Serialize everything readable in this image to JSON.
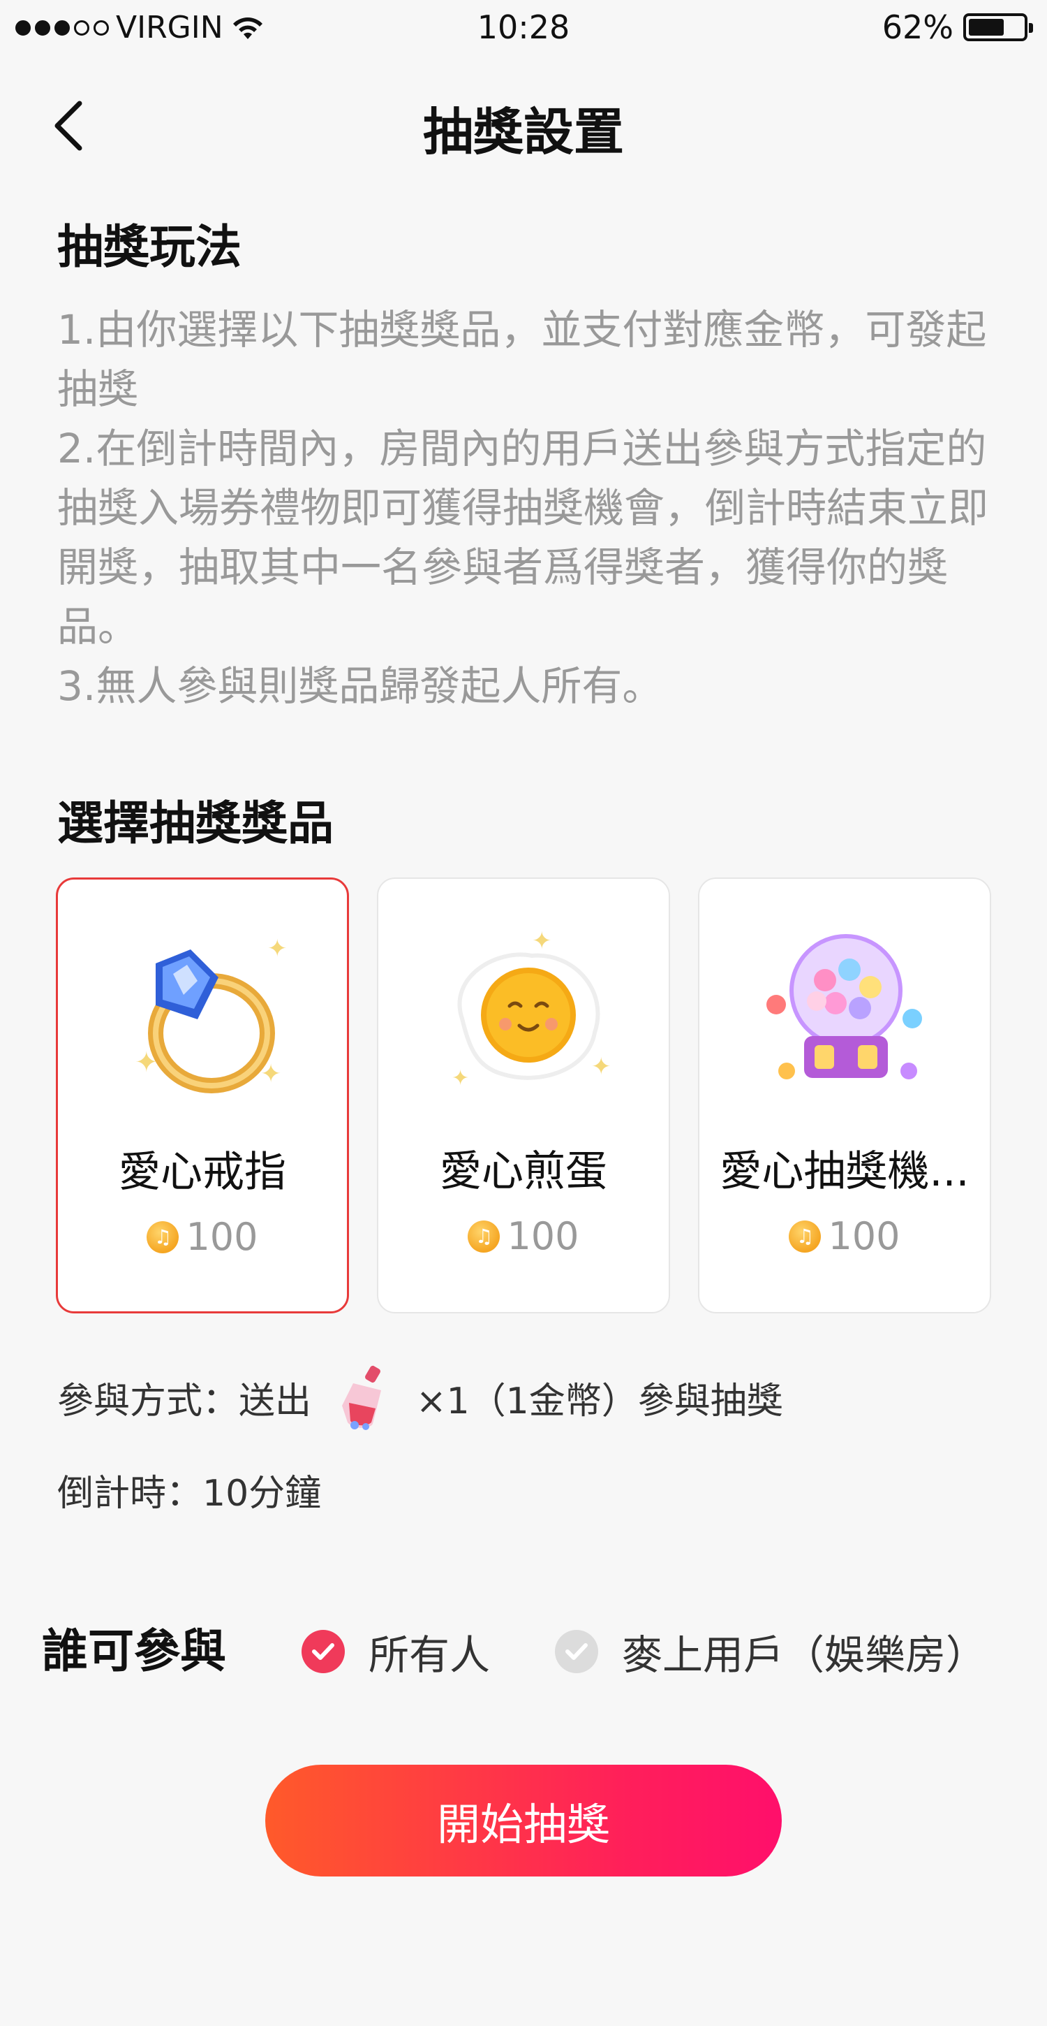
{
  "status_bar": {
    "carrier": "VIRGIN",
    "time": "10:28",
    "battery": "62%"
  },
  "nav": {
    "title": "抽獎設置"
  },
  "rules": {
    "title": "抽獎玩法",
    "lines": [
      "1.由你選擇以下抽獎獎品，並支付對應金幣，可發起抽獎",
      "2.在倒計時間內，房間內的用戶送出參與方式指定的抽獎入場券禮物即可獲得抽獎機會，倒計時結束立即開獎，抽取其中一名參與者爲得獎者，獲得你的獎品。",
      "3.無人參與則獎品歸發起人所有。"
    ]
  },
  "prizes": {
    "title": "選擇抽獎獎品",
    "items": [
      {
        "name": "愛心戒指",
        "price": "100",
        "selected": true,
        "icon": "ring-icon"
      },
      {
        "name": "愛心煎蛋",
        "price": "100",
        "selected": false,
        "icon": "fried-egg-icon"
      },
      {
        "name": "愛心抽獎機...",
        "price": "100",
        "selected": false,
        "icon": "gacha-machine-icon"
      }
    ]
  },
  "participation": {
    "prefix": "參與方式：送出",
    "suffix": "×1（1金幣）參與抽獎",
    "gift_icon": "bottle-gift-icon"
  },
  "countdown": {
    "text": "倒計時：10分鐘"
  },
  "audience": {
    "label": "誰可參與",
    "options": [
      {
        "label": "所有人",
        "checked": true
      },
      {
        "label": "麥上用戶（娛樂房）",
        "checked": false
      }
    ]
  },
  "start_button": {
    "label": "開始抽獎"
  },
  "colors": {
    "accent": "#f03a5a",
    "button_start": "#ff5a2a",
    "button_end": "#ff0f6b",
    "selected_border": "#e83a3a"
  }
}
